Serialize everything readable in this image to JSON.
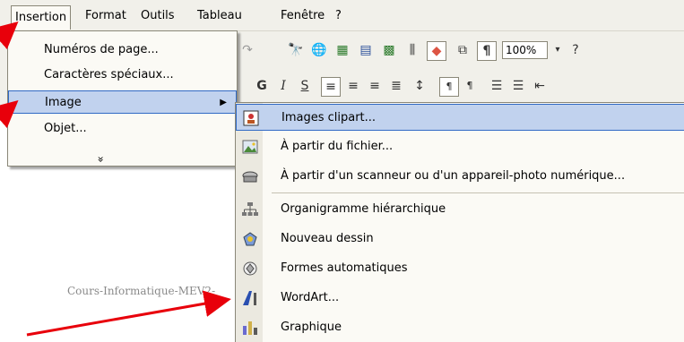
{
  "menubar": {
    "items": [
      "Insertion",
      "Format",
      "Outils",
      "Tableau",
      "Fenêtre",
      "?"
    ]
  },
  "toolbar": {
    "zoom": "100%",
    "bold": "G",
    "italic": "I",
    "underline": "S"
  },
  "insertion_menu": {
    "items": [
      {
        "label": "Numéros de page..."
      },
      {
        "label": "Caractères spéciaux..."
      },
      {
        "label": "Image",
        "submenu": true
      },
      {
        "label": "Objet..."
      }
    ],
    "expand": "»"
  },
  "image_submenu": {
    "items": [
      {
        "label": "Images clipart...",
        "icon": "clipart-icon"
      },
      {
        "label": "À partir du fichier...",
        "icon": "picture-file-icon"
      },
      {
        "label": "À partir d'un scanneur ou d'un appareil-photo numérique...",
        "icon": "scanner-icon"
      },
      {
        "label": "Organigramme hiérarchique",
        "icon": "org-chart-icon"
      },
      {
        "label": "Nouveau dessin",
        "icon": "drawing-canvas-icon"
      },
      {
        "label": "Formes automatiques",
        "icon": "autoshapes-icon"
      },
      {
        "label": "WordArt...",
        "icon": "wordart-icon"
      },
      {
        "label": "Graphique",
        "icon": "chart-icon"
      }
    ]
  },
  "document": {
    "footer_text": "Cours-Informatique-MEV2-"
  },
  "colors": {
    "highlight": "#c1d2ee",
    "highlight_border": "#316ac5",
    "arrow": "#e8000b"
  }
}
